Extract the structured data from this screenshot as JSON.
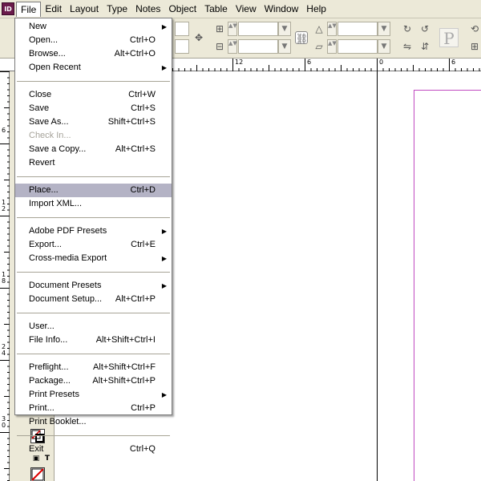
{
  "app": {
    "icon_label": "ID"
  },
  "menubar": {
    "items": [
      "File",
      "Edit",
      "Layout",
      "Type",
      "Notes",
      "Object",
      "Table",
      "View",
      "Window",
      "Help"
    ]
  },
  "ruler": {
    "h_labels": [
      "12",
      "6",
      "0",
      "6"
    ],
    "v_labels": [
      "6",
      "1 2",
      "1 8",
      "2 4",
      "3 0"
    ]
  },
  "file_menu": {
    "new": {
      "label": "New",
      "shortcut": ""
    },
    "open": {
      "label": "Open...",
      "shortcut": "Ctrl+O"
    },
    "browse": {
      "label": "Browse...",
      "shortcut": "Alt+Ctrl+O"
    },
    "open_recent": {
      "label": "Open Recent",
      "shortcut": ""
    },
    "close": {
      "label": "Close",
      "shortcut": "Ctrl+W"
    },
    "save": {
      "label": "Save",
      "shortcut": "Ctrl+S"
    },
    "save_as": {
      "label": "Save As...",
      "shortcut": "Shift+Ctrl+S"
    },
    "check_in": {
      "label": "Check In...",
      "shortcut": ""
    },
    "save_copy": {
      "label": "Save a Copy...",
      "shortcut": "Alt+Ctrl+S"
    },
    "revert": {
      "label": "Revert",
      "shortcut": ""
    },
    "place": {
      "label": "Place...",
      "shortcut": "Ctrl+D"
    },
    "import_xml": {
      "label": "Import XML...",
      "shortcut": ""
    },
    "pdf_presets": {
      "label": "Adobe PDF Presets",
      "shortcut": ""
    },
    "export": {
      "label": "Export...",
      "shortcut": "Ctrl+E"
    },
    "cross_media": {
      "label": "Cross-media Export",
      "shortcut": ""
    },
    "doc_presets": {
      "label": "Document Presets",
      "shortcut": ""
    },
    "doc_setup": {
      "label": "Document Setup...",
      "shortcut": "Alt+Ctrl+P"
    },
    "user": {
      "label": "User...",
      "shortcut": ""
    },
    "file_info": {
      "label": "File Info...",
      "shortcut": "Alt+Shift+Ctrl+I"
    },
    "preflight": {
      "label": "Preflight...",
      "shortcut": "Alt+Shift+Ctrl+F"
    },
    "package": {
      "label": "Package...",
      "shortcut": "Alt+Shift+Ctrl+P"
    },
    "print_presets": {
      "label": "Print Presets",
      "shortcut": ""
    },
    "print": {
      "label": "Print...",
      "shortcut": "Ctrl+P"
    },
    "print_booklet": {
      "label": "Print Booklet...",
      "shortcut": ""
    },
    "exit": {
      "label": "Exit",
      "shortcut": "Ctrl+Q"
    }
  },
  "colors": {
    "highlight": "#b4b3c5",
    "page_edge": "#c04ac0",
    "chrome": "#ece9d8"
  }
}
